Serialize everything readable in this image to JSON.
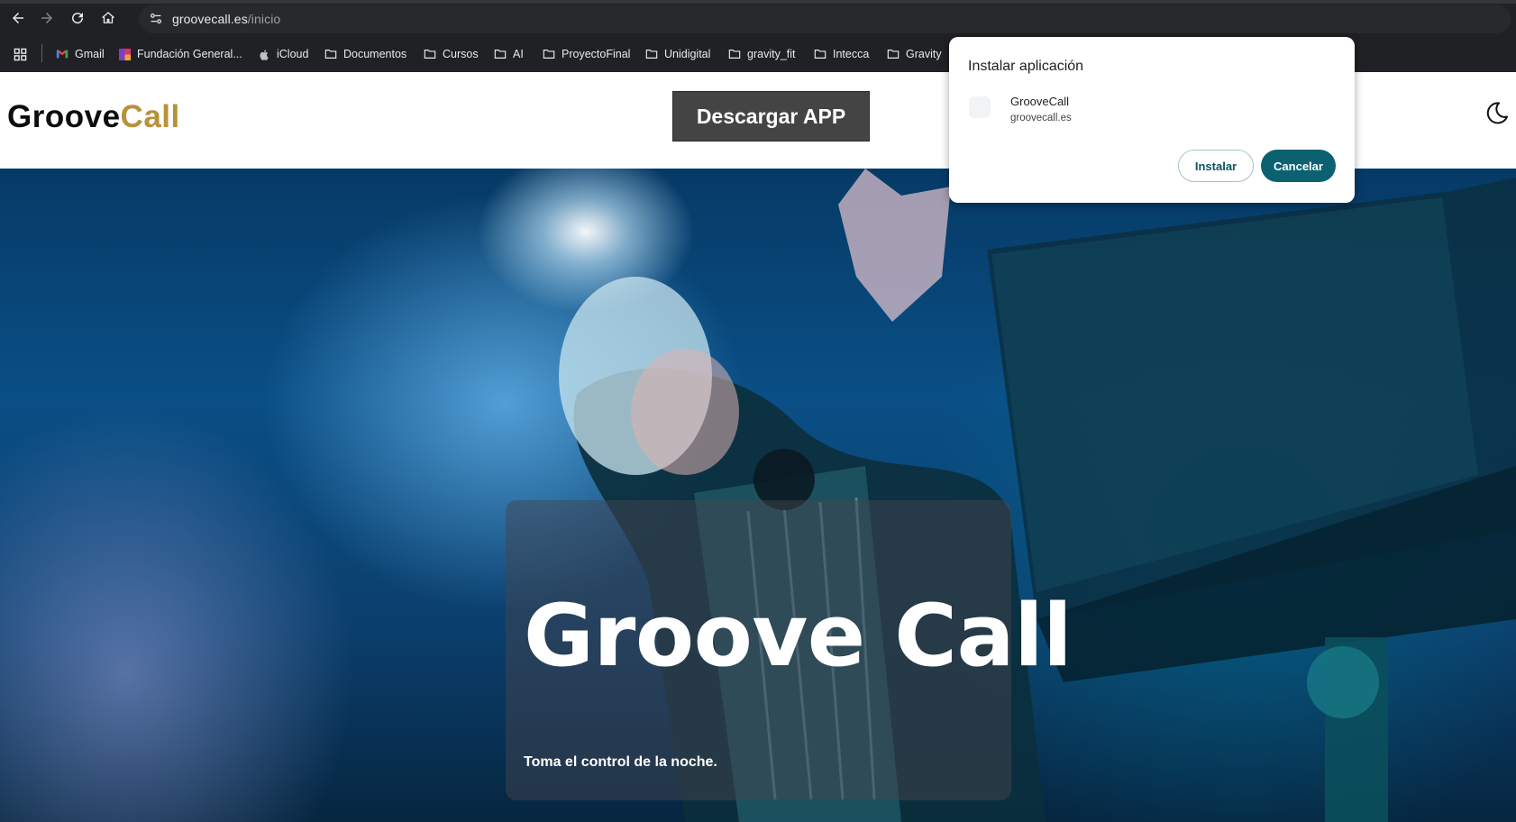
{
  "browser": {
    "url_host": "groovecall.es",
    "url_path": "/inicio",
    "bookmarks": [
      {
        "label": "Gmail",
        "icon": "gmail-icon"
      },
      {
        "label": "Fundación General...",
        "icon": "site-icon"
      },
      {
        "label": "iCloud",
        "icon": "apple-icon"
      },
      {
        "label": "Documentos",
        "icon": "folder-icon"
      },
      {
        "label": "Cursos",
        "icon": "folder-icon"
      },
      {
        "label": "AI",
        "icon": "folder-icon"
      },
      {
        "label": "ProyectoFinal",
        "icon": "folder-icon"
      },
      {
        "label": "Unidigital",
        "icon": "folder-icon"
      },
      {
        "label": "gravity_fit",
        "icon": "folder-icon"
      },
      {
        "label": "Intecca",
        "icon": "folder-icon"
      },
      {
        "label": "Gravity",
        "icon": "folder-icon"
      }
    ]
  },
  "site": {
    "logo_part1": "Groove",
    "logo_part2": "Call",
    "download_label": "Descargar APP",
    "hero_title": "Groove Call",
    "hero_subtitle": "Toma el control de la noche."
  },
  "install_dialog": {
    "title": "Instalar aplicación",
    "app_name": "GrooveCall",
    "app_url": "groovecall.es",
    "install_label": "Instalar",
    "cancel_label": "Cancelar"
  },
  "colors": {
    "logo_accent": "#b8923a",
    "cancel_button": "#0b6170",
    "download_button": "#444444"
  }
}
